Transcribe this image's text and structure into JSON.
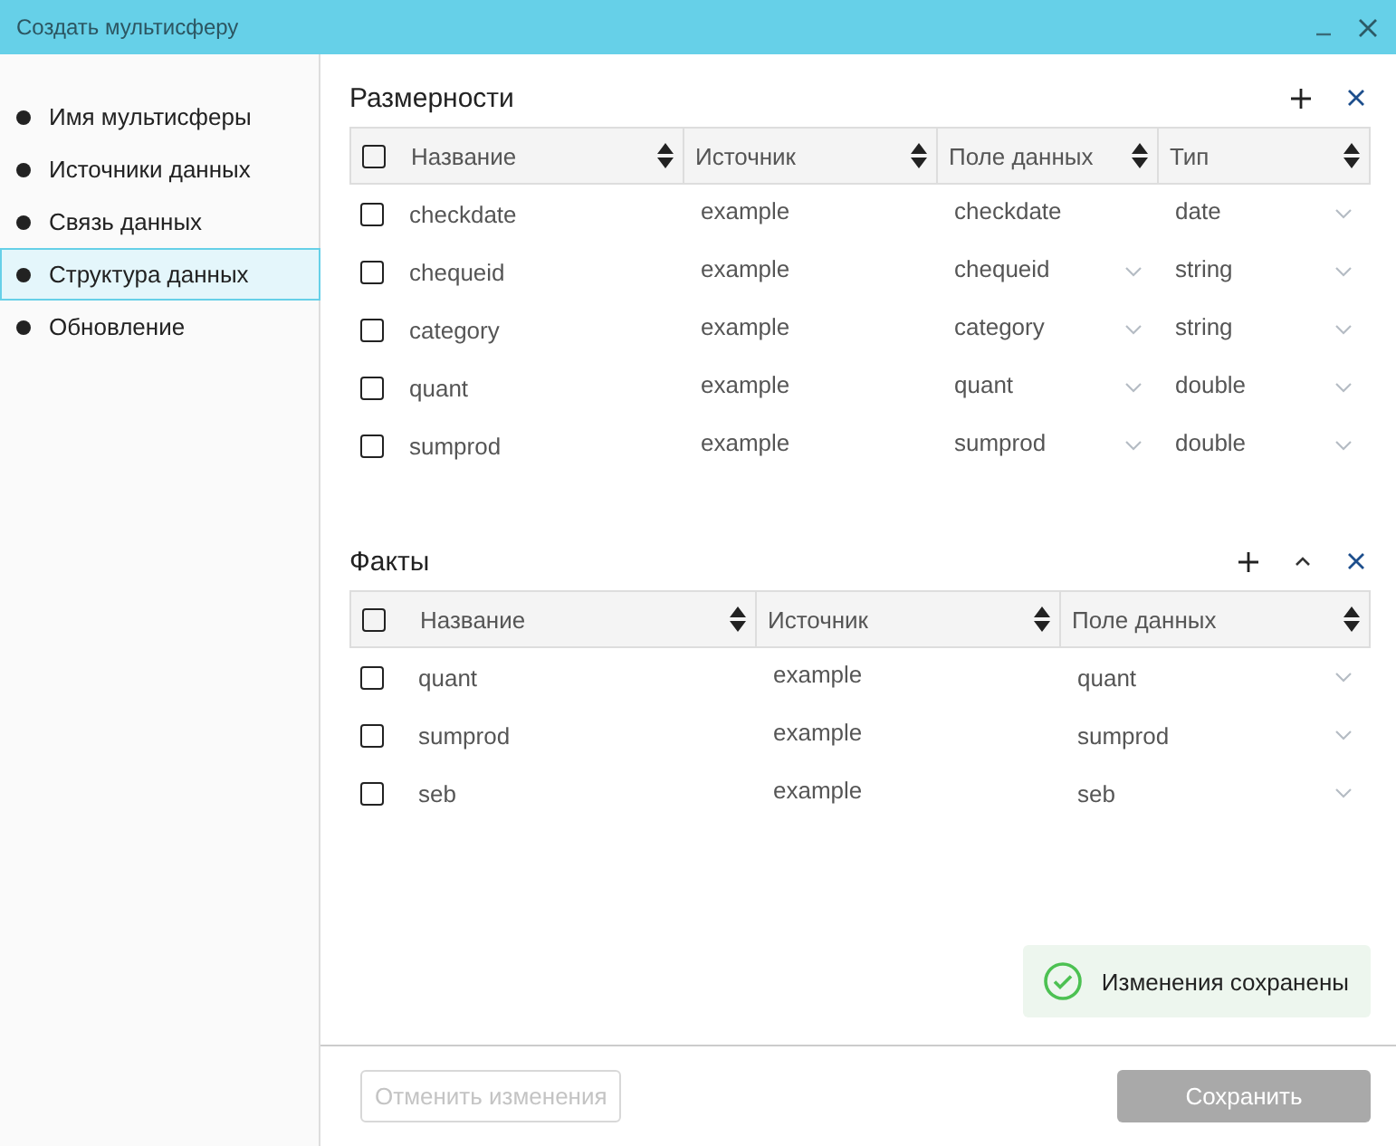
{
  "window": {
    "title": "Создать мультисферу"
  },
  "sidebar": {
    "items": [
      {
        "label": "Имя мультисферы",
        "selected": false
      },
      {
        "label": "Источники данных",
        "selected": false
      },
      {
        "label": "Связь данных",
        "selected": false
      },
      {
        "label": "Структура данных",
        "selected": true
      },
      {
        "label": "Обновление",
        "selected": false
      }
    ]
  },
  "dimensions": {
    "title": "Размерности",
    "actions": [
      {
        "kind": "add"
      },
      {
        "kind": "close"
      }
    ],
    "columns": [
      "Название",
      "Источник",
      "Поле данных",
      "Тип"
    ],
    "all_checked": false,
    "rows": [
      {
        "checked": false,
        "name": "checkdate",
        "source": "example",
        "field": {
          "value": "checkdate",
          "dropdown": false
        },
        "type": {
          "value": "date",
          "dropdown": true
        }
      },
      {
        "checked": false,
        "name": "chequeid",
        "source": "example",
        "field": {
          "value": "chequeid",
          "dropdown": true
        },
        "type": {
          "value": "string",
          "dropdown": true
        }
      },
      {
        "checked": false,
        "name": "category",
        "source": "example",
        "field": {
          "value": "category",
          "dropdown": true
        },
        "type": {
          "value": "string",
          "dropdown": true
        }
      },
      {
        "checked": false,
        "name": "quant",
        "source": "example",
        "field": {
          "value": "quant",
          "dropdown": true
        },
        "type": {
          "value": "double",
          "dropdown": true
        }
      },
      {
        "checked": false,
        "name": "sumprod",
        "source": "example",
        "field": {
          "value": "sumprod",
          "dropdown": true
        },
        "type": {
          "value": "double",
          "dropdown": true
        }
      }
    ]
  },
  "facts": {
    "title": "Факты",
    "actions": [
      {
        "kind": "add"
      },
      {
        "kind": "collapse"
      },
      {
        "kind": "close"
      }
    ],
    "columns": [
      "Название",
      "Источник",
      "Поле данных"
    ],
    "all_checked": false,
    "rows": [
      {
        "checked": false,
        "name": "quant",
        "source": "example",
        "field": {
          "value": "quant",
          "dropdown": true
        }
      },
      {
        "checked": false,
        "name": "sumprod",
        "source": "example",
        "field": {
          "value": "sumprod",
          "dropdown": true
        }
      },
      {
        "checked": false,
        "name": "seb",
        "source": "example",
        "field": {
          "value": "seb",
          "dropdown": true
        }
      }
    ]
  },
  "toast": {
    "text": "Изменения сохранены"
  },
  "buttons": [
    {
      "label": "Отменить изменения",
      "kind": "secondary",
      "disabled": true
    },
    {
      "label": "Сохранить",
      "kind": "primary",
      "disabled": true
    }
  ]
}
